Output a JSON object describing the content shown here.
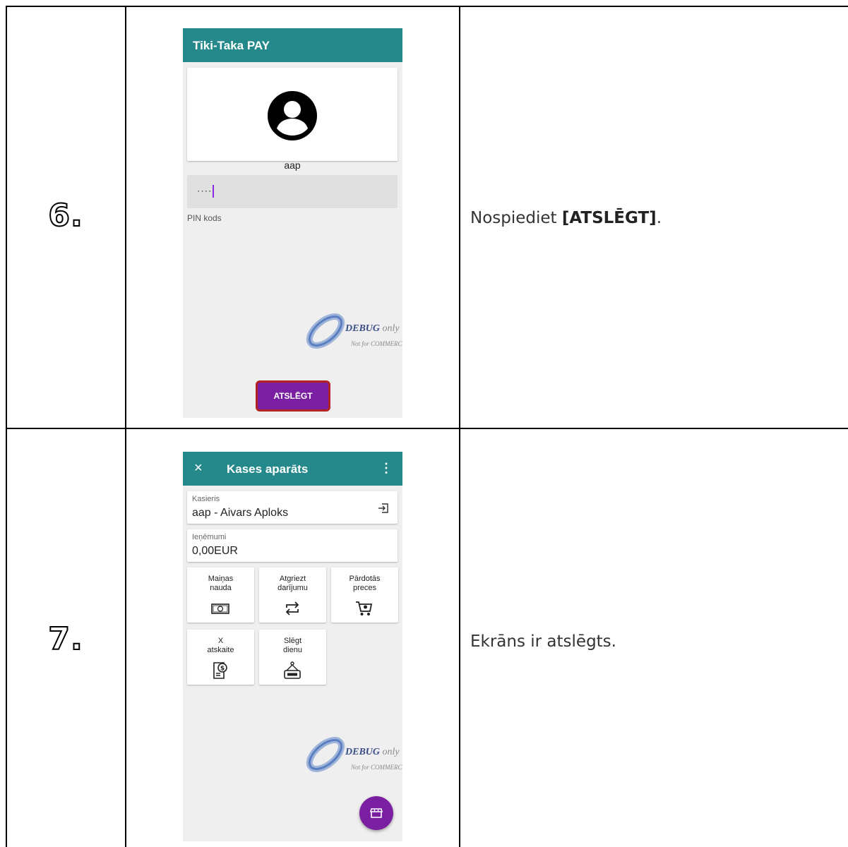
{
  "rows": [
    {
      "number": "6.",
      "description_prefix": "Nospiediet ",
      "description_bold": "[ATSLĒGT]",
      "description_suffix": "."
    },
    {
      "number": "7.",
      "description": "Ekrāns ir atslēgts."
    }
  ],
  "login_screen": {
    "app_title": "Tiki-Taka PAY",
    "username": "aap",
    "pin_value": "····",
    "pin_label": "PIN kods",
    "unlock_button": "ATSLĒGT"
  },
  "register_screen": {
    "title": "Kases aparāts",
    "close_icon": "×",
    "menu_icon": "⋮",
    "cashier_label": "Kasieris",
    "cashier_value": "aap - Aivars Aploks",
    "revenue_label": "Ieņēmumi",
    "revenue_value": "0,00EUR",
    "tiles": [
      {
        "label": "Maiņas\nnauda",
        "icon": "cash-icon"
      },
      {
        "label": "Atgriezt\ndarījumu",
        "icon": "return-icon"
      },
      {
        "label": "Pārdotās\npreces",
        "icon": "cart-icon"
      },
      {
        "label": "X\natskaite",
        "icon": "report-icon"
      },
      {
        "label": "Slēgt\ndienu",
        "icon": "close-sign-icon"
      }
    ]
  },
  "watermark": {
    "line1": "DEBUG",
    "line1_suffix": "only",
    "line2": "Not for COMMERCIAL"
  },
  "colors": {
    "appbar": "#25898c",
    "button": "#7b1fa2",
    "button_border": "#b22222",
    "screen_bg": "#efefef"
  }
}
